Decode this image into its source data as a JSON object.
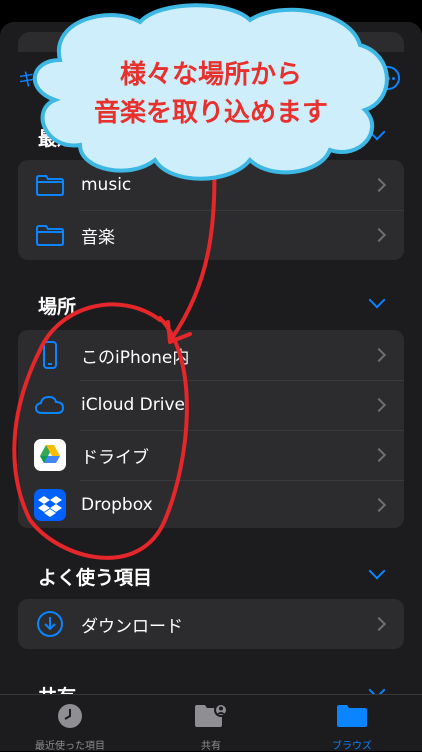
{
  "nav": {
    "cancel_label": "キャンセル"
  },
  "sections": {
    "recent": {
      "title": "最近"
    },
    "places": {
      "title": "場所"
    },
    "favorites": {
      "title": "よく使う項目"
    },
    "shared": {
      "title": "共有"
    }
  },
  "recent_items": [
    {
      "label": "music",
      "icon": "folder-icon"
    },
    {
      "label": "音楽",
      "icon": "folder-icon"
    }
  ],
  "place_items": [
    {
      "label": "このiPhone内",
      "icon": "iphone-icon"
    },
    {
      "label": "iCloud Drive",
      "icon": "icloud-icon"
    },
    {
      "label": "ドライブ",
      "icon": "google-drive-icon"
    },
    {
      "label": "Dropbox",
      "icon": "dropbox-icon"
    }
  ],
  "favorite_items": [
    {
      "label": "ダウンロード",
      "icon": "download-icon"
    }
  ],
  "tabs": [
    {
      "label": "最近使った項目",
      "icon": "clock-icon"
    },
    {
      "label": "共有",
      "icon": "shared-folder-icon"
    },
    {
      "label": "ブラウズ",
      "icon": "folder-icon",
      "active": true
    }
  ],
  "annotation": {
    "line1": "様々な場所から",
    "line2": "音楽を取り込めます",
    "text_color": "#e8302d",
    "cloud_fill": "#cdeefa",
    "cloud_stroke": "#3db7e4"
  },
  "colors": {
    "accent": "#0a84ff",
    "background": "#1c1c1e",
    "row": "#2c2c2e"
  }
}
